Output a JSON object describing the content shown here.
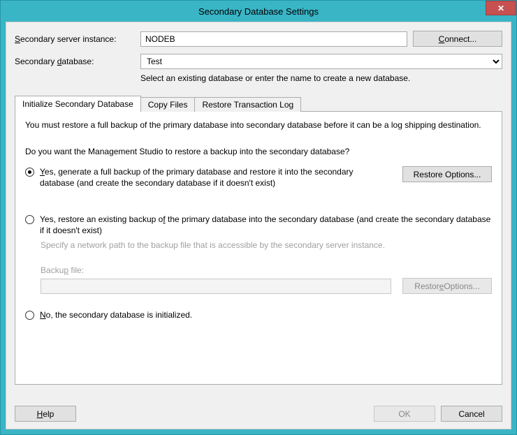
{
  "window": {
    "title": "Secondary Database Settings",
    "close_glyph": "✕"
  },
  "form": {
    "server_label_pre": "S",
    "server_label_post": "econdary server instance:",
    "server_value": "NODEB",
    "connect_label": "Connect...",
    "db_label_pre": "Secondary ",
    "db_label_u": "d",
    "db_label_post": "atabase:",
    "db_value": "Test",
    "db_hint": "Select an existing database or enter the name to create a new database."
  },
  "tabs": {
    "t1": "Initialize Secondary Database",
    "t2": "Copy Files",
    "t3": "Restore Transaction Log"
  },
  "panel": {
    "info": "You must restore a full backup of the primary database into secondary database before it can be a log shipping destination.",
    "prompt": "Do you want the Management Studio to restore a backup into the secondary database?",
    "opt1_pre": "Y",
    "opt1_post": "es, generate a full backup of the primary database and restore it into the secondary database (and create the secondary database if it doesn't exist)",
    "restore1": "Restore Options...",
    "opt2": "Yes, restore an existing backup of the primary database into the secondary database (and create the secondary database if it doesn't exist)",
    "opt2_sub": "Specify a network path to the backup file that is accessible by the secondary server instance.",
    "backup_label": "Backup file:",
    "restore2": "Restore Options...",
    "opt3_pre": "N",
    "opt3_post": "o, the secondary database is initialized."
  },
  "buttons": {
    "help": "Help",
    "ok": "OK",
    "cancel": "Cancel"
  }
}
